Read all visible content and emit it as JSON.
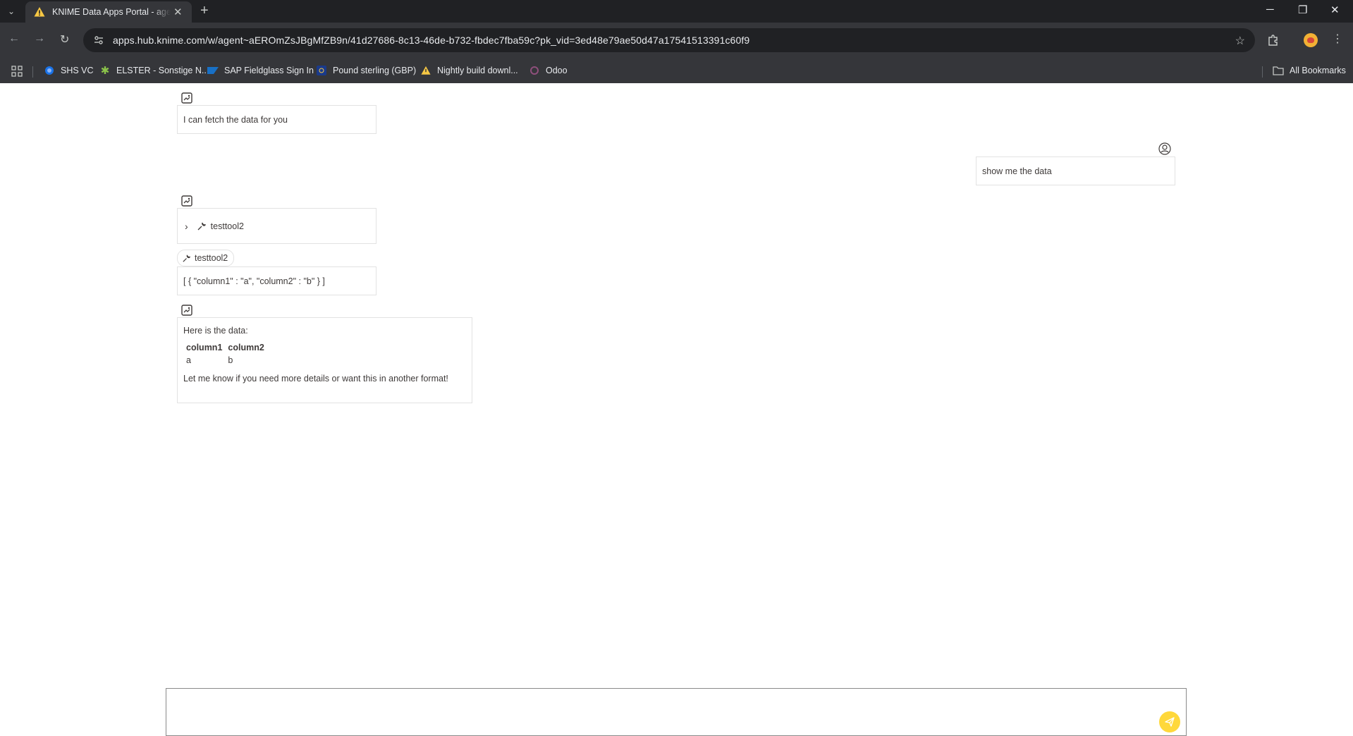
{
  "browser": {
    "tab": {
      "title": "KNIME Data Apps Portal - agent",
      "close_label": "✕"
    },
    "new_tab_label": "+",
    "url": "apps.hub.knime.com/w/agent~aEROmZsJBgMfZB9n/41d27686-8c13-46de-b732-fbdec7fba59c?pk_vid=3ed48e79ae50d47a17541513391c60f9",
    "bookmarks": [
      {
        "label": "SHS VC",
        "icon": "globe-icon"
      },
      {
        "label": "ELSTER - Sonstige N...",
        "icon": "elster-icon"
      },
      {
        "label": "SAP Fieldglass Sign In",
        "icon": "sap-icon"
      },
      {
        "label": "Pound sterling (GBP)",
        "icon": "euro-icon"
      },
      {
        "label": "Nightly build downl...",
        "icon": "warning-icon"
      },
      {
        "label": "Odoo",
        "icon": "odoo-icon"
      }
    ],
    "all_bookmarks_label": "All Bookmarks"
  },
  "chat": {
    "messages": [
      {
        "role": "agent",
        "text": "I can fetch the data for you"
      },
      {
        "role": "user",
        "text": "show me the data"
      },
      {
        "role": "agent",
        "tool_call": "testtool2"
      },
      {
        "role": "tool",
        "tool_name": "testtool2",
        "text": "[ { \"column1\" : \"a\", \"column2\" : \"b\" } ]"
      },
      {
        "role": "agent",
        "intro": "Here is the data:",
        "table": {
          "headers": [
            "column1",
            "column2"
          ],
          "rows": [
            [
              "a",
              "b"
            ]
          ]
        },
        "outro": "Let me know if you need more details or want this in another format!"
      }
    ],
    "composer": {
      "value": "",
      "placeholder": ""
    }
  },
  "colors": {
    "send_button": "#ffd83b",
    "chrome_dark": "#202124",
    "chrome_toolbar": "#35363a"
  }
}
